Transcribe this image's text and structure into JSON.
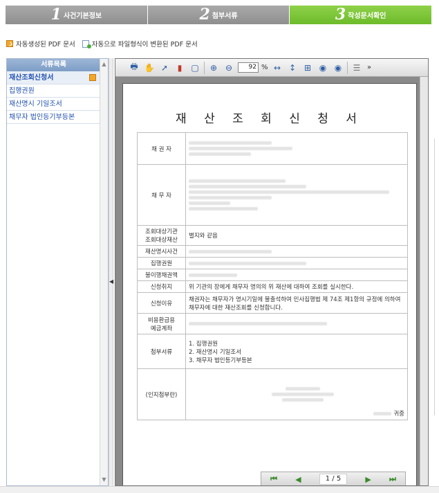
{
  "steps": [
    {
      "num": "1",
      "label": "사건기본정보"
    },
    {
      "num": "2",
      "label": "첨부서류"
    },
    {
      "num": "3",
      "label": "작성문서확인"
    }
  ],
  "legend": {
    "auto_pdf": "자동생성된 PDF 문서",
    "converted_pdf": "자동으로 파일형식이 변환된 PDF 문서"
  },
  "sidebar": {
    "title": "서류목록",
    "items": [
      {
        "label": "재산조회신청서"
      },
      {
        "label": "집행권원"
      },
      {
        "label": "재산명시 기일조서"
      },
      {
        "label": "채무자 법인등기부등본"
      }
    ]
  },
  "toolbar": {
    "zoom_value": "92",
    "zoom_unit": "%",
    "more": "»"
  },
  "document": {
    "title": "재 산 조 회 신 청 서",
    "rows": {
      "creditor": "채 권 자",
      "debtor": "채 무 자",
      "inquiry_target": "조회대상기관\n조회대상재산",
      "inquiry_target_value": "별지와 같음",
      "disclosure_case": "재산명시사건",
      "enforcement_title": "집행권원",
      "default_claim": "불이행채권액",
      "purpose": "신청취지",
      "purpose_value": "위 기관의 장에게 채무자 명의의 위 재산에 대하여 조회를 실시한다.",
      "reason": "신청이유",
      "reason_value": "채권자는 채무자가 명시기일에 불출석하여 민사집행법 제 74조 제1항의 규정에 의하여 채무자에 대한 재산조회를 신청합니다.",
      "refund_account": "비용환급용\n예금계좌",
      "attachments": "첨부서류",
      "attachments_list": [
        "1.    집행권원",
        "2.    재산명시 기일조서",
        "3.    채무자 법인등기부등본"
      ],
      "stamp": "(인지첨부란)",
      "court_suffix": "귀중"
    }
  },
  "pager": {
    "current": "1",
    "total": "5",
    "separator": "/"
  }
}
